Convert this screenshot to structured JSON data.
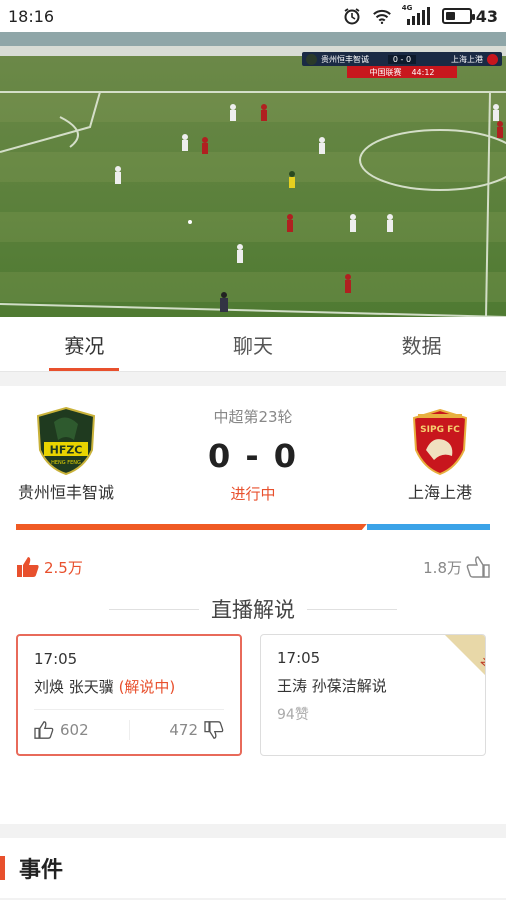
{
  "status_bar": {
    "time": "18:16",
    "network": "4G",
    "battery": "43"
  },
  "video": {
    "scorebug": {
      "home_team": "贵州恒丰智诚",
      "score": "0 - 0",
      "away_team": "上海上港",
      "broadcaster": "中国联赛",
      "clock": "44:12"
    }
  },
  "tabs": [
    {
      "label": "赛况",
      "active": true
    },
    {
      "label": "聊天",
      "active": false
    },
    {
      "label": "数据",
      "active": false
    }
  ],
  "match": {
    "round": "中超第23轮",
    "score": "0 - 0",
    "status": "进行中",
    "home": {
      "name": "贵州恒丰智诚",
      "logo_text": "HFZC",
      "logo_sub": "HENG FENG"
    },
    "away": {
      "name": "上海上港",
      "logo_text": "SIPG FC"
    },
    "home_support": 0.74,
    "home_likes": "2.5万",
    "away_likes": "1.8万"
  },
  "live_commentary": {
    "title": "直播解说",
    "cards": [
      {
        "time": "17:05",
        "hosts": "刘焕 张天骥",
        "tag": "(解说中)",
        "up": "602",
        "down": "472"
      },
      {
        "time": "17:05",
        "hosts": "王涛 孙葆洁解说",
        "praise": "94赞",
        "badge": "会员"
      }
    ]
  },
  "events": {
    "title": "事件"
  },
  "colors": {
    "accent": "#e8502d",
    "home_bar": "#f05a24",
    "away_bar": "#3ba3e8"
  }
}
